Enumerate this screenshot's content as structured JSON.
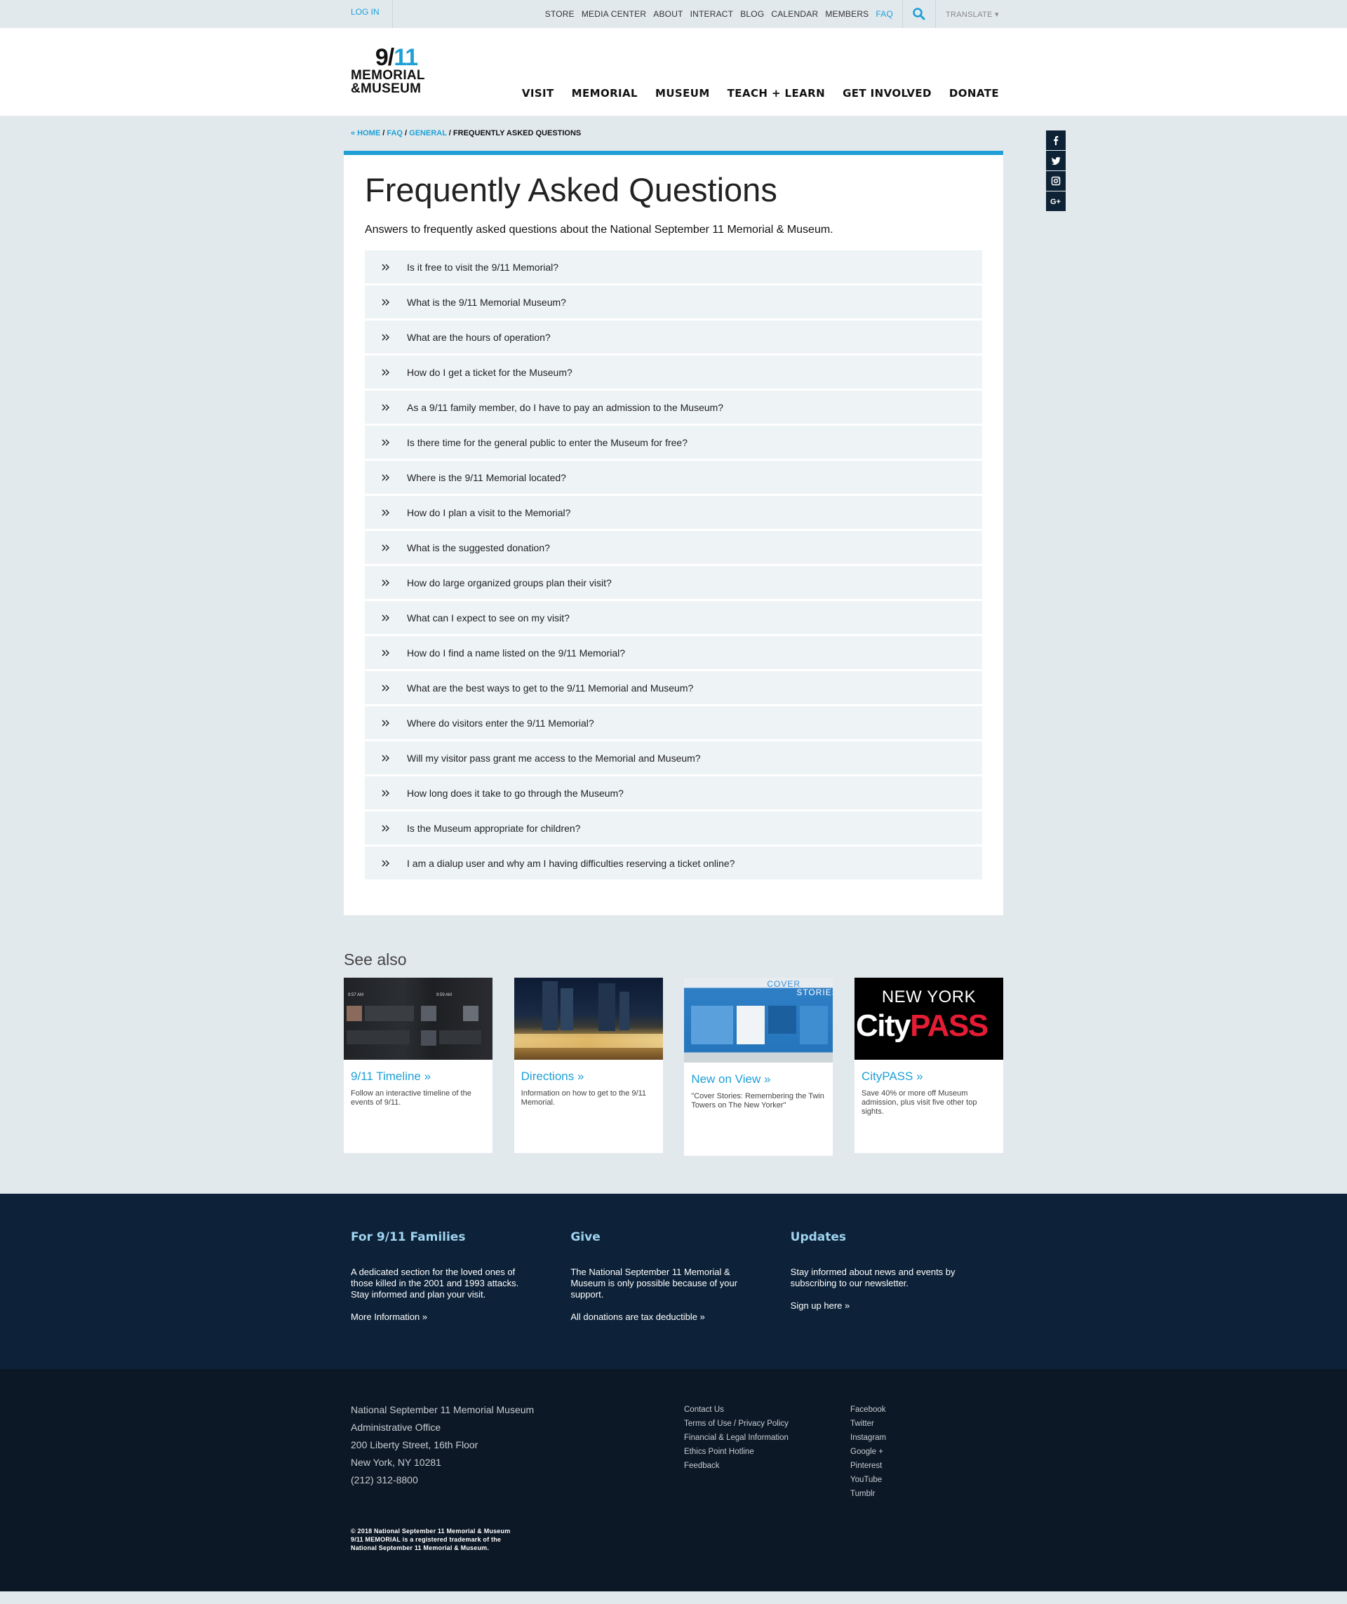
{
  "topbar": {
    "login": "LOG IN",
    "links": [
      "STORE",
      "MEDIA CENTER",
      "ABOUT",
      "INTERACT",
      "BLOG",
      "CALENDAR",
      "MEMBERS",
      "FAQ"
    ],
    "translate": "TRANSLATE ▾"
  },
  "logo": {
    "num_a": "9/",
    "num_b": "11",
    "line1": "MEMORIAL",
    "line2": "&MUSEUM"
  },
  "nav": [
    "VISIT",
    "MEMORIAL",
    "MUSEUM",
    "TEACH + LEARN",
    "GET INVOLVED",
    "DONATE"
  ],
  "breadcrumb": {
    "home": "« HOME",
    "faq": "FAQ",
    "general": "GENERAL",
    "current": "FREQUENTLY ASKED QUESTIONS",
    "sep": " / "
  },
  "page": {
    "title": "Frequently Asked Questions",
    "intro": "Answers to frequently asked questions about the National September 11 Memorial & Museum."
  },
  "faq": [
    "Is it free to visit the 9/11 Memorial?",
    "What is the 9/11 Memorial Museum?",
    "What are the hours of operation?",
    "How do I get a ticket for the Museum?",
    "As a 9/11 family member, do I have to pay an admission to the Museum?",
    "Is there time for the general public to enter the Museum for free?",
    "Where is the 9/11 Memorial located?",
    "How do I plan a visit to the Memorial?",
    "What is the suggested donation?",
    "How do large organized groups plan their visit?",
    "What can I expect to see on my visit?",
    "How do I find a name listed on the 9/11 Memorial?",
    "What are the best ways to get to the 9/11 Memorial and Museum?",
    "Where do visitors enter the 9/11 Memorial?",
    "Will my visitor pass grant me access to the Memorial and Museum?",
    "How long does it take to go through the Museum?",
    "Is the Museum appropriate for children?",
    "I am a dialup user and why am I having difficulties reserving a ticket online?"
  ],
  "seealso": {
    "heading": "See also",
    "cards": [
      {
        "title": "9/11 Timeline »",
        "text": "Follow an interactive timeline of the events of 9/11.",
        "img_time1": "9:57 AM",
        "img_time2": "9:59 AM"
      },
      {
        "title": "Directions »",
        "text": "Information on how to get to the 9/11 Memorial."
      },
      {
        "title": "New on View »",
        "text": "\"Cover Stories: Remembering the Twin Towers on The New Yorker\"",
        "img_text1": "COVER",
        "img_text2": "STORIES"
      },
      {
        "title": "CityPASS »",
        "text": "Save 40% or more off Museum admission, plus visit five other top sights.",
        "img_line1": "NEW YORK",
        "img_city": "City",
        "img_pass": "PASS"
      }
    ]
  },
  "families": [
    {
      "heading": "For 9/11 Families",
      "text": "A dedicated section for the loved ones of those killed in the 2001 and 1993 attacks. Stay informed and plan your visit.",
      "link": "More Information »"
    },
    {
      "heading": "Give",
      "text": "The National September 11 Memorial & Museum is only possible because of your support.",
      "link": "All donations are tax deductible »"
    },
    {
      "heading": "Updates",
      "text": "Stay informed about news and events by subscribing to our newsletter.",
      "link": "Sign up here »"
    }
  ],
  "footer": {
    "address": [
      "National September 11 Memorial Museum",
      "Administrative Office",
      "200 Liberty Street, 16th Floor",
      "New York, NY 10281",
      "(212) 312-8800"
    ],
    "links": [
      "Contact Us",
      "Terms of Use / Privacy Policy",
      "Financial & Legal Information",
      "Ethics Point Hotline",
      "Feedback"
    ],
    "social": [
      "Facebook",
      "Twitter",
      "Instagram",
      "Google +",
      "Pinterest",
      "YouTube",
      "Tumblr"
    ],
    "copyright": [
      "© 2018 National September 11 Memorial & Museum",
      "9/11 MEMORIAL is a registered trademark of the",
      "National September 11 Memorial & Museum."
    ]
  },
  "colors": {
    "accent": "#1ea0d7",
    "navy": "#0d2238",
    "footer": "#0d1826",
    "bg": "#e2e9ed"
  }
}
